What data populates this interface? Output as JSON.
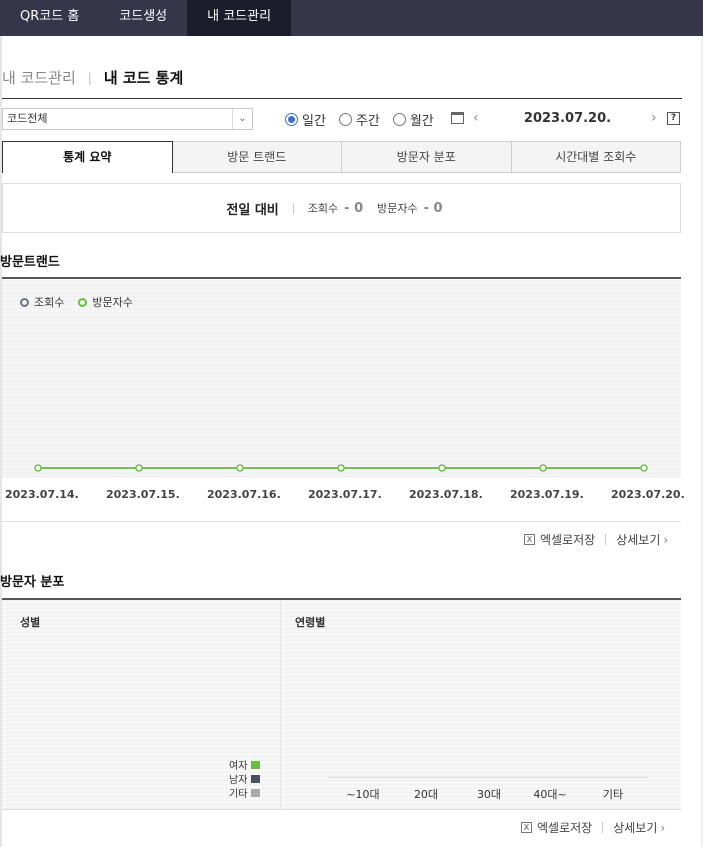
{
  "nav": {
    "tabs": [
      "QR코드 홈",
      "코드생성",
      "내 코드관리"
    ],
    "active": 2
  },
  "breadcrumb": {
    "parent": "내 코드관리",
    "current": "내 코드 통계"
  },
  "filter": {
    "select_value": "코드전체",
    "radios": [
      {
        "label": "일간",
        "checked": true
      },
      {
        "label": "주간",
        "checked": false
      },
      {
        "label": "월간",
        "checked": false
      }
    ],
    "date": "2023.07.20.",
    "help": "?"
  },
  "tabs": [
    "통계 요약",
    "방문 트랜드",
    "방문자 분포",
    "시간대별 조회수"
  ],
  "summary": {
    "label": "전일 대비",
    "views_label": "조회수",
    "views_value": "- 0",
    "visitors_label": "방문자수",
    "visitors_value": "- 0"
  },
  "trend": {
    "title": "방문트랜드",
    "legend": [
      "조회수",
      "방문자수"
    ]
  },
  "chart_data": {
    "type": "line",
    "x": [
      "2023.07.14.",
      "2023.07.15.",
      "2023.07.16.",
      "2023.07.17.",
      "2023.07.18.",
      "2023.07.19.",
      "2023.07.20."
    ],
    "series": [
      {
        "name": "조회수",
        "values": [
          0,
          0,
          0,
          0,
          0,
          0,
          0
        ],
        "color": "#6c7382"
      },
      {
        "name": "방문자수",
        "values": [
          0,
          0,
          0,
          0,
          0,
          0,
          0
        ],
        "color": "#65c13d"
      }
    ],
    "ylim": [
      0,
      1
    ],
    "grid": true,
    "legend_position": "top-left"
  },
  "links": {
    "excel": "엑셀로저장",
    "detail": "상세보기"
  },
  "distribution": {
    "title": "방문자 분포",
    "gender_title": "성별",
    "age_title": "연령별",
    "gender_legend": [
      {
        "label": "여자",
        "color": "#65c13d"
      },
      {
        "label": "남자",
        "color": "#4a5060"
      },
      {
        "label": "기타",
        "color": "#aaaaaa"
      }
    ],
    "age_groups": [
      "~10대",
      "20대",
      "30대",
      "40대~",
      "기타"
    ]
  }
}
